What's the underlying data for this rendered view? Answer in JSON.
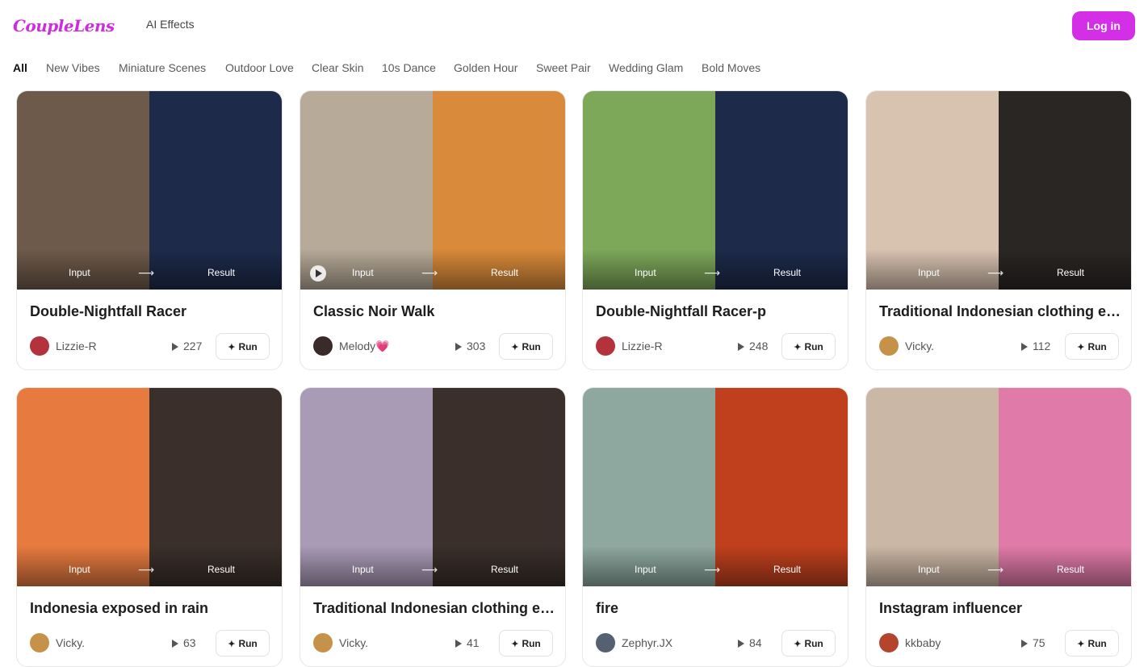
{
  "header": {
    "logo": "CoupleLens",
    "nav_ai_effects": "AI Effects",
    "login_label": "Log in"
  },
  "tabs": [
    "All",
    "New Vibes",
    "Miniature Scenes",
    "Outdoor Love",
    "Clear Skin",
    "10s Dance",
    "Golden Hour",
    "Sweet Pair",
    "Wedding Glam",
    "Bold Moves"
  ],
  "media_labels": {
    "input": "Input",
    "result": "Result",
    "arrow": "⟶"
  },
  "cards": [
    {
      "title": "Double-Nightfall Racer",
      "author": "Lizzie-R",
      "plays": "227",
      "run_label": "Run",
      "colors": {
        "left": "#6e5a4a",
        "right": "#1d2a4a",
        "avatar": "#b4323b"
      }
    },
    {
      "title": "Classic Noir Walk",
      "author": "Melody💗",
      "plays": "303",
      "run_label": "Run",
      "colors": {
        "left": "#b7aa98",
        "right": "#d98a3a",
        "avatar": "#3a2a2a"
      }
    },
    {
      "title": "Double-Nightfall Racer-p",
      "author": "Lizzie-R",
      "plays": "248",
      "run_label": "Run",
      "colors": {
        "left": "#7da85a",
        "right": "#1d2a4a",
        "avatar": "#b4323b"
      }
    },
    {
      "title": "Traditional Indonesian clothing ex...",
      "author": "Vicky.",
      "plays": "112",
      "run_label": "Run",
      "colors": {
        "left": "#d8c2b0",
        "right": "#2a2624",
        "avatar": "#c6924a"
      }
    },
    {
      "title": "Indonesia exposed in rain",
      "author": "Vicky.",
      "plays": "63",
      "run_label": "Run",
      "colors": {
        "left": "#e67a3f",
        "right": "#3a2f2a",
        "avatar": "#c6924a"
      }
    },
    {
      "title": "Traditional Indonesian clothing ex...",
      "author": "Vicky.",
      "plays": "41",
      "run_label": "Run",
      "colors": {
        "left": "#a99ab6",
        "right": "#3a2f2a",
        "avatar": "#c6924a"
      }
    },
    {
      "title": "fire",
      "author": "Zephyr.JX",
      "plays": "84",
      "run_label": "Run",
      "colors": {
        "left": "#8ea8a0",
        "right": "#c0401e",
        "avatar": "#556070"
      }
    },
    {
      "title": "Instagram influencer",
      "author": "kkbaby",
      "plays": "75",
      "run_label": "Run",
      "colors": {
        "left": "#cbb7a5",
        "right": "#e07aa8",
        "avatar": "#b4452c"
      }
    }
  ]
}
